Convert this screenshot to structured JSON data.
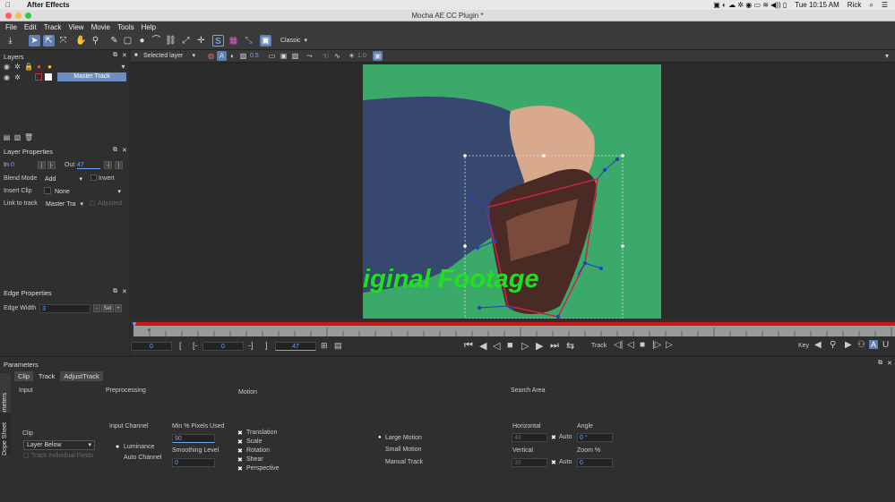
{
  "macos": {
    "app_name": "After Effects",
    "time": "Tue 10:15 AM",
    "user": "Rick"
  },
  "window": {
    "title": "Mocha AE CC Plugin *"
  },
  "menu": [
    "File",
    "Edit",
    "Track",
    "View",
    "Movie",
    "Tools",
    "Help"
  ],
  "toolbar": {
    "view_mode": "Classic"
  },
  "layers_panel": {
    "title": "Layers",
    "layer_name": "Master Track"
  },
  "viewer_bar": {
    "layer_select": "Selected layer",
    "opacity_value": "0.5",
    "value_1": "1.0"
  },
  "layer_props": {
    "title": "Layer Properties",
    "in_label": "In",
    "in_value": "0",
    "out_label": "Out",
    "out_value": "47",
    "blend_label": "Blend Mode",
    "blend_value": "Add",
    "invert_label": "Invert",
    "insert_label": "Insert Clip",
    "insert_value": "None",
    "link_label": "Link to track",
    "link_value": "Master Tra",
    "adjusted_label": "Adjusted"
  },
  "edge_props": {
    "title": "Edge Properties",
    "width_label": "Edge Width",
    "width_value": "3",
    "set_label": "Set"
  },
  "canvas": {
    "overlay_text": "iginal Footage"
  },
  "timeline": {
    "frame_start": "0",
    "in_point": "0",
    "out_point": "47",
    "track_label": "Track",
    "key_label": "Key"
  },
  "parameters": {
    "title": "Parameters",
    "tabs": [
      "Clip",
      "Track",
      "AdjustTrack"
    ],
    "side_tabs": [
      "Parameters",
      "Dope Sheet"
    ],
    "input_section": "Input",
    "clip_label": "Clip",
    "clip_value": "Layer Below",
    "track_individual_fields": "Track Individual Fields",
    "preprocessing_section": "Preprocessing",
    "input_channel_label": "Input Channel",
    "channels": [
      "Luminance",
      "Auto Channel"
    ],
    "min_pixels_label": "Min % Pixels Used",
    "min_pixels_value": "90",
    "smoothing_label": "Smoothing Level",
    "smoothing_value": "0",
    "motion_section": "Motion",
    "motions": [
      "Translation",
      "Scale",
      "Rotation",
      "Shear",
      "Perspective"
    ],
    "motion_types": [
      "Large Motion",
      "Small Motion",
      "Manual Track"
    ],
    "search_section": "Search Area",
    "horizontal_label": "Horizontal",
    "horizontal_value": "48",
    "vertical_label": "Vertical",
    "vertical_value": "39",
    "auto_label": "Auto",
    "angle_label": "Angle",
    "angle_value": "0 °",
    "zoom_label": "Zoom %",
    "zoom_value": "0"
  }
}
